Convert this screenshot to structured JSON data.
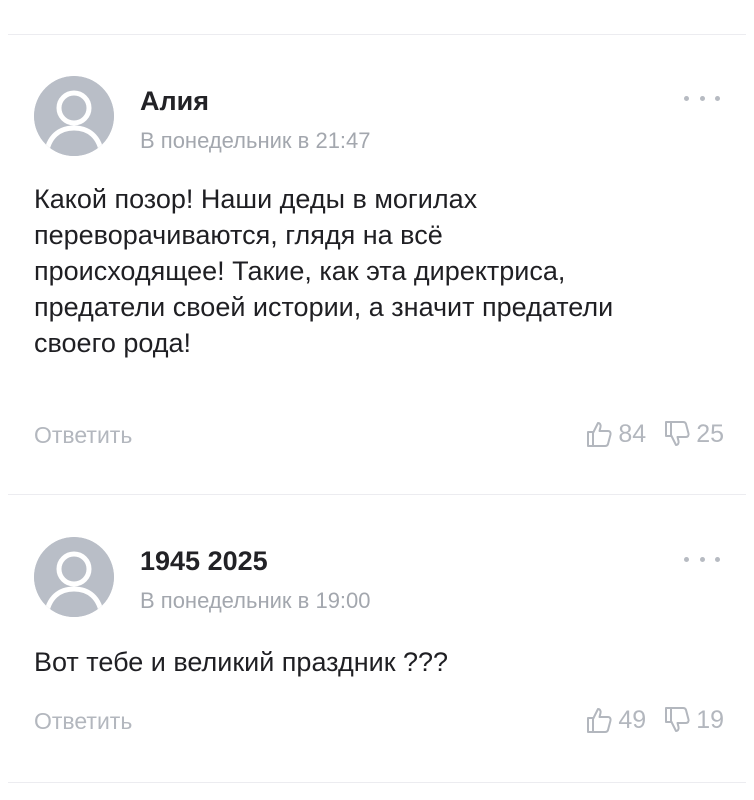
{
  "comments": [
    {
      "author": "Алия",
      "time": "В понедельник в 21:47",
      "lines": [
        "Какой позор! Наши деды в могилах",
        "переворачиваются, глядя на всё",
        "происходящее! Такие, как эта директриса,",
        "предатели своей истории, а значит предатели",
        "своего рода!"
      ],
      "reply_label": "Ответить",
      "likes": "84",
      "dislikes": "25"
    },
    {
      "author": "1945 2025",
      "time": "В понедельник в 19:00",
      "lines": [
        "Вот тебе и великий праздник ???"
      ],
      "reply_label": "Ответить",
      "likes": "49",
      "dislikes": "19"
    }
  ],
  "icons": {
    "avatar": "default-user-avatar-icon",
    "more": "more-dots-icon",
    "like": "thumbs-up-icon",
    "dislike": "thumbs-down-icon"
  },
  "colors": {
    "avatar_bg": "#b9bec7",
    "muted_text": "#a3a7ae",
    "main_text": "#1f1f23"
  }
}
